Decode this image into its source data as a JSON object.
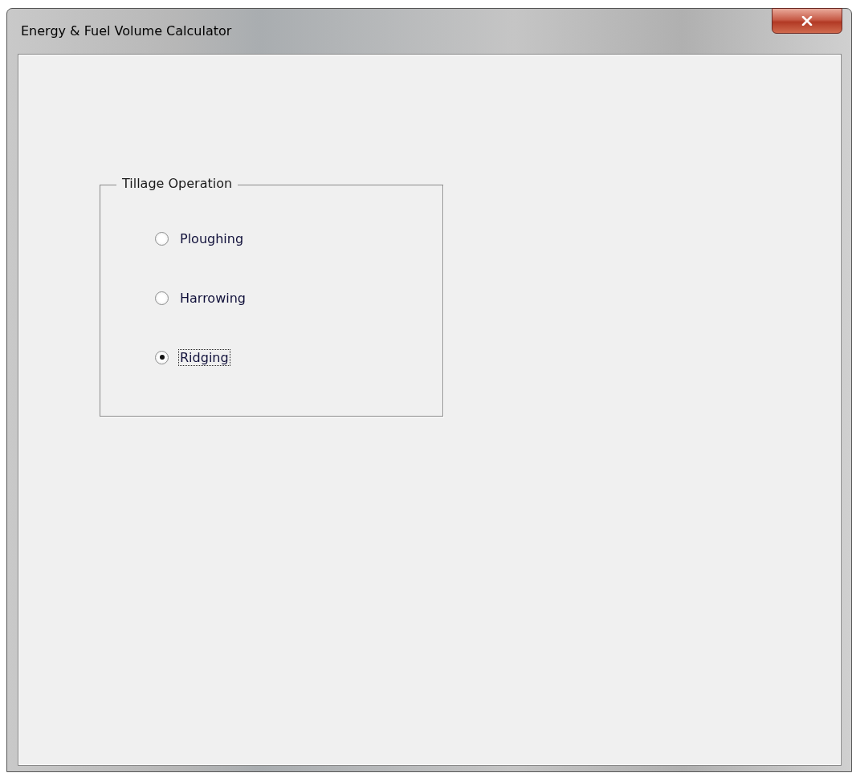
{
  "window": {
    "title": "Energy & Fuel Volume Calculator"
  },
  "group": {
    "title": "Tillage Operation",
    "options": [
      {
        "label": "Ploughing",
        "selected": false,
        "focused": false
      },
      {
        "label": "Harrowing",
        "selected": false,
        "focused": false
      },
      {
        "label": "Ridging",
        "selected": true,
        "focused": true
      }
    ]
  }
}
